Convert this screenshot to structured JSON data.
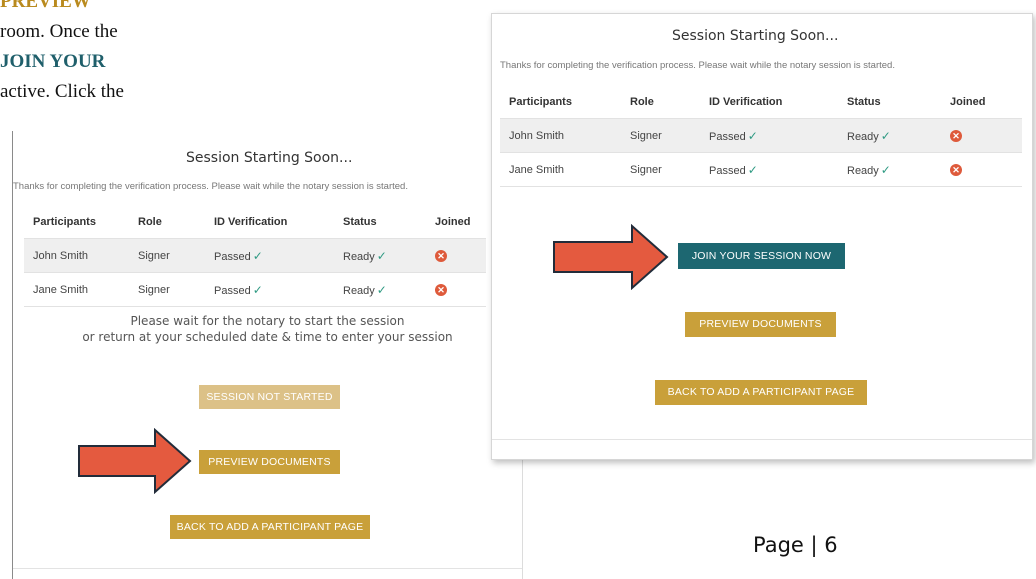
{
  "doc": {
    "line1": "PREVIEW",
    "line2": "room.  Once the",
    "line3": "JOIN YOUR",
    "line4": "active.  Click the",
    "page_label": "Page  |  6"
  },
  "left_panel": {
    "title": "Session Starting Soon...",
    "note": "Thanks for completing the verification process. Please wait while the notary session is started.",
    "headers": [
      "Participants",
      "Role",
      "ID Verification",
      "Status",
      "Joined"
    ],
    "rows": [
      {
        "name": "John Smith",
        "role": "Signer",
        "id": "Passed",
        "status": "Ready"
      },
      {
        "name": "Jane Smith",
        "role": "Signer",
        "id": "Passed",
        "status": "Ready"
      }
    ],
    "wait_line1": "Please wait for the notary to start the session",
    "wait_line2": "or return at your scheduled date & time to enter your session",
    "btn_not_started": "SESSION NOT STARTED",
    "btn_preview": "PREVIEW DOCUMENTS",
    "btn_back": "BACK TO ADD A PARTICIPANT PAGE"
  },
  "right_panel": {
    "title": "Session Starting Soon...",
    "note": "Thanks for completing the verification process. Please wait while the notary session is started.",
    "headers": [
      "Participants",
      "Role",
      "ID Verification",
      "Status",
      "Joined"
    ],
    "rows": [
      {
        "name": "John Smith",
        "role": "Signer",
        "id": "Passed",
        "status": "Ready"
      },
      {
        "name": "Jane Smith",
        "role": "Signer",
        "id": "Passed",
        "status": "Ready"
      }
    ],
    "btn_join": "JOIN YOUR SESSION NOW",
    "btn_preview": "PREVIEW DOCUMENTS",
    "btn_back": "BACK TO ADD A PARTICIPANT PAGE"
  },
  "icons": {
    "check": "checkmark-icon",
    "not_joined": "x-circle-icon",
    "pointer": "arrow-right-icon"
  },
  "colors": {
    "gold_button": "#c9a03a",
    "faded_gold_button": "#dcc187",
    "teal_button": "#1d6771",
    "arrow_fill": "#e45a3f",
    "check_green": "#2f9a83",
    "x_red": "#de5a3b"
  }
}
